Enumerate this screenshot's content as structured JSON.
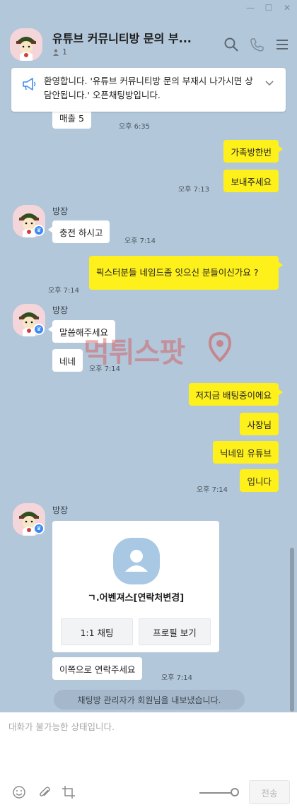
{
  "room": {
    "title": "유튜브 커뮤니티방 문의 부...",
    "member_count": "1"
  },
  "notice": {
    "text": "환영합니다. '유튜브 커뮤니티방 문의 부재시 나가시면 상담안됩니다.' 오픈채팅방입니다."
  },
  "messages": {
    "m0": {
      "text": "매출 5",
      "time": "오후 6:35"
    },
    "m1": {
      "text": "가족방한번"
    },
    "m2": {
      "text": "보내주세요",
      "time": "오후 7:13"
    },
    "g1": {
      "sender": "방장"
    },
    "m3": {
      "text": "충전 하시고",
      "time": "오후 7:14"
    },
    "m4": {
      "text": "픽스터분들 네임드좀 잇으신 분들이신가요 ?",
      "time": "오후 7:14"
    },
    "g2": {
      "sender": "방장"
    },
    "m5": {
      "text": "말씀해주세요"
    },
    "m6": {
      "text": "네네",
      "time": "오후 7:14"
    },
    "m7": {
      "text": "저지금 배팅중이에요"
    },
    "m8": {
      "text": "사장님"
    },
    "m9": {
      "text": "닉네임 유튜브"
    },
    "m10": {
      "text": "입니다",
      "time": "오후 7:14"
    },
    "g3": {
      "sender": "방장"
    },
    "m12": {
      "text": "이쪽으로 연락주세요",
      "time": "오후 7:14"
    }
  },
  "profile_card": {
    "name": "ㄱ.어벤져스[연락처변경]",
    "chat_button": "1:1 채팅",
    "profile_button": "프로필 보기"
  },
  "watermark": "먹튀스팟",
  "system_message": "채팅방 관리자가 회원님을 내보냈습니다.",
  "composer": {
    "placeholder": "대화가 불가능한 상태입니다.",
    "send_label": "전송"
  },
  "icons": {
    "header": [
      "search-icon",
      "call-icon",
      "menu-icon"
    ],
    "notice": "megaphone-icon",
    "toolbar": [
      "emoji-icon",
      "attach-icon",
      "capture-icon"
    ]
  },
  "colors": {
    "background": "#b2c7da",
    "my_bubble": "#fef01b",
    "other_bubble": "#ffffff",
    "badge": "#3d8bf2"
  }
}
